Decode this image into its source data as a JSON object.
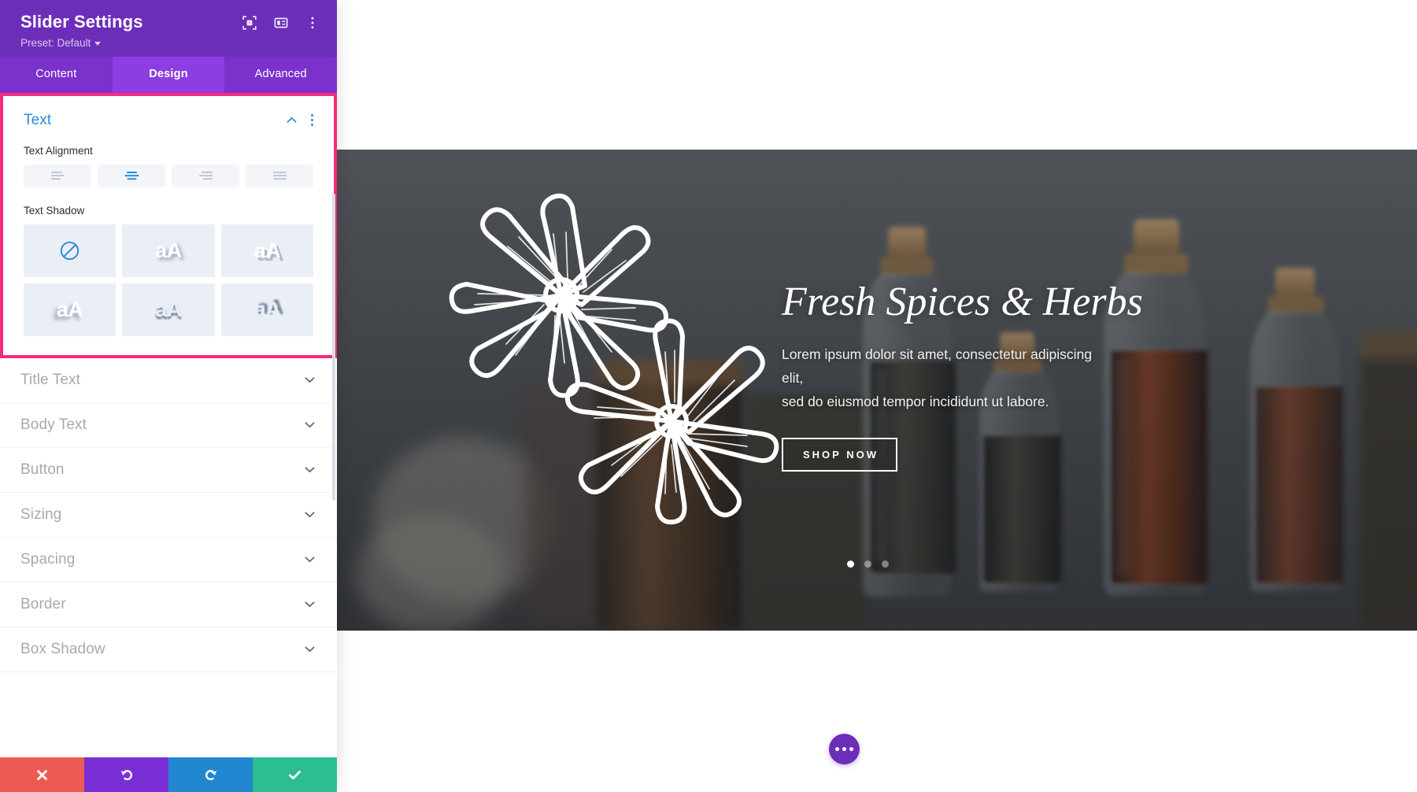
{
  "panel": {
    "title": "Slider Settings",
    "preset_label": "Preset: Default",
    "header_icons": [
      {
        "name": "focus-target-icon",
        "glyph": "focus"
      },
      {
        "name": "layout-panel-icon",
        "glyph": "layout"
      },
      {
        "name": "more-options-icon",
        "glyph": "dots"
      }
    ],
    "tabs": [
      {
        "label": "Content",
        "active": false
      },
      {
        "label": "Design",
        "active": true
      },
      {
        "label": "Advanced",
        "active": false
      }
    ],
    "open_section": {
      "title": "Text",
      "collapse_icon": "chevron-up-icon",
      "options_icon": "vertical-dots-icon",
      "text_alignment": {
        "label": "Text Alignment",
        "options": [
          {
            "value": "left",
            "icon": "align-left-icon",
            "active": false
          },
          {
            "value": "center",
            "icon": "align-center-icon",
            "active": true
          },
          {
            "value": "right",
            "icon": "align-right-icon",
            "active": false
          },
          {
            "value": "justify",
            "icon": "align-justify-icon",
            "active": false
          }
        ]
      },
      "text_shadow": {
        "label": "Text Shadow",
        "options": [
          {
            "value": "none",
            "icon": "no-shadow-icon",
            "sample": "",
            "active": true
          },
          {
            "value": "shadow-soft",
            "icon": "aA-sample",
            "sample": "aA",
            "active": false
          },
          {
            "value": "shadow-hard",
            "icon": "aA-sample",
            "sample": "aA",
            "active": false
          },
          {
            "value": "shadow-left",
            "icon": "aA-sample",
            "sample": "aA",
            "active": false
          },
          {
            "value": "shadow-down",
            "icon": "aA-sample",
            "sample": "aA",
            "active": false
          },
          {
            "value": "shadow-up",
            "icon": "aA-sample",
            "sample": "aA",
            "active": false
          }
        ]
      }
    },
    "collapsed_sections": [
      {
        "label": "Title Text"
      },
      {
        "label": "Body Text"
      },
      {
        "label": "Button"
      },
      {
        "label": "Sizing"
      },
      {
        "label": "Spacing"
      },
      {
        "label": "Border"
      },
      {
        "label": "Box Shadow"
      }
    ],
    "actions": [
      {
        "name": "cancel",
        "icon": "close-icon",
        "color": "#ec5a51"
      },
      {
        "name": "undo",
        "icon": "undo-icon",
        "color": "#7a2fd6"
      },
      {
        "name": "redo",
        "icon": "redo-icon",
        "color": "#2187d0"
      },
      {
        "name": "save",
        "icon": "check-icon",
        "color": "#2dbd92"
      }
    ],
    "highlight_color": "#f72a7c"
  },
  "canvas": {
    "slider": {
      "title": "Fresh Spices & Herbs",
      "subtitle_line1": "Lorem ipsum dolor sit amet, consectetur adipiscing elit,",
      "subtitle_line2": "sed do eiusmod tempor incididunt ut labore.",
      "button_label": "SHOP NOW",
      "dots": [
        {
          "active": true
        },
        {
          "active": false
        },
        {
          "active": false
        }
      ]
    },
    "fab": {
      "name": "page-settings-fab",
      "icon": "three-dots-icon",
      "color": "#6c2eb9"
    }
  }
}
